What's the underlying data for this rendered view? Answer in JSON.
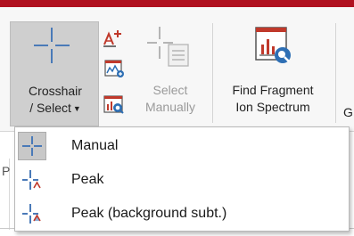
{
  "window": {
    "accent_color": "#b0101f"
  },
  "ribbon": {
    "crosshair_button": {
      "line1": "Crosshair",
      "line2": "/ Select",
      "icon": "crosshair-icon",
      "state": "pressed"
    },
    "mini_buttons": [
      {
        "icon": "annotate-peak-icon"
      },
      {
        "icon": "add-spectrum-icon"
      },
      {
        "icon": "spectrum-search-icon"
      }
    ],
    "select_manually_button": {
      "line1": "Select",
      "line2": "Manually",
      "icon": "select-manually-icon",
      "state": "disabled"
    },
    "find_fragment_button": {
      "line1": "Find Fragment",
      "line2": "Ion Spectrum",
      "icon": "find-fragment-spectrum-icon"
    },
    "clipped_next_label": "G"
  },
  "background": {
    "clipped_text": "P"
  },
  "dropdown": {
    "items": [
      {
        "label": "Manual",
        "icon": "crosshair-manual-icon",
        "selected": true
      },
      {
        "label": "Peak",
        "icon": "crosshair-peak-icon",
        "selected": false
      },
      {
        "label": "Peak (background subt.)",
        "icon": "crosshair-peak-background-icon",
        "selected": false
      }
    ]
  }
}
